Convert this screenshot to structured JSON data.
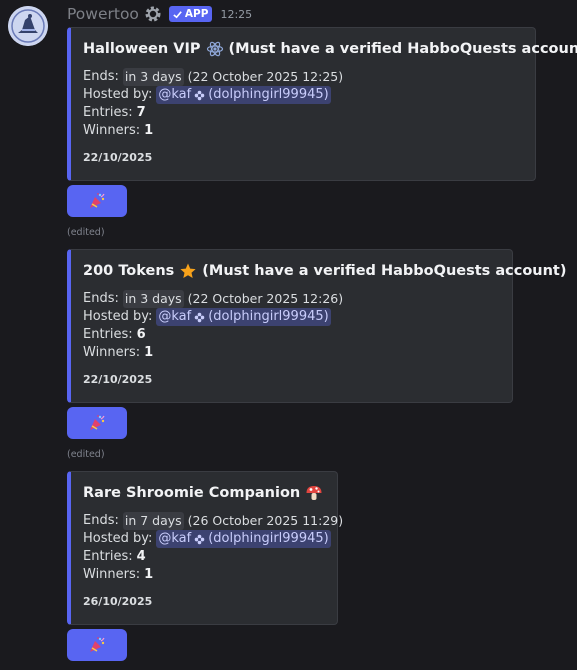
{
  "message": {
    "username": "Powertoo",
    "badge_label": "APP",
    "timestamp": "12:25",
    "avatar_icon": "witch-hat-avatar"
  },
  "giveaways": [
    {
      "title_before": "Halloween VIP",
      "title_after": "(Must have a verified HabboQuests account)",
      "title_icon": "atom-icon",
      "ends_label": "Ends:",
      "ends_relative": "in 3 days",
      "ends_absolute": "(22 October 2025 12:25)",
      "hosted_label": "Hosted by:",
      "host_mention": "@kaf",
      "host_name": "(dolphingirl99945)",
      "entries_label": "Entries:",
      "entries": "7",
      "winners_label": "Winners:",
      "winners": "1",
      "date": "22/10/2025",
      "button_icon": "party-popper-icon",
      "edited": "(edited)"
    },
    {
      "title_before": "200 Tokens",
      "title_after": "(Must have a verified HabboQuests account)",
      "title_icon": "star-icon",
      "ends_label": "Ends:",
      "ends_relative": "in 3 days",
      "ends_absolute": "(22 October 2025 12:26)",
      "hosted_label": "Hosted by:",
      "host_mention": "@kaf",
      "host_name": "(dolphingirl99945)",
      "entries_label": "Entries:",
      "entries": "6",
      "winners_label": "Winners:",
      "winners": "1",
      "date": "22/10/2025",
      "button_icon": "party-popper-icon",
      "edited": "(edited)"
    },
    {
      "title_before": "Rare Shroomie Companion",
      "title_after": "",
      "title_icon": "mushroom-icon",
      "ends_label": "Ends:",
      "ends_relative": "in 7 days",
      "ends_absolute": "(26 October 2025 11:29)",
      "hosted_label": "Hosted by:",
      "host_mention": "@kaf",
      "host_name": "(dolphingirl99945)",
      "entries_label": "Entries:",
      "entries": "4",
      "winners_label": "Winners:",
      "winners": "1",
      "date": "26/10/2025",
      "button_icon": "party-popper-icon"
    }
  ],
  "colors": {
    "background": "#1a1a1e",
    "embed_bg": "#2b2d31",
    "accent": "#5865f2",
    "mention_bg": "#3c4270"
  }
}
